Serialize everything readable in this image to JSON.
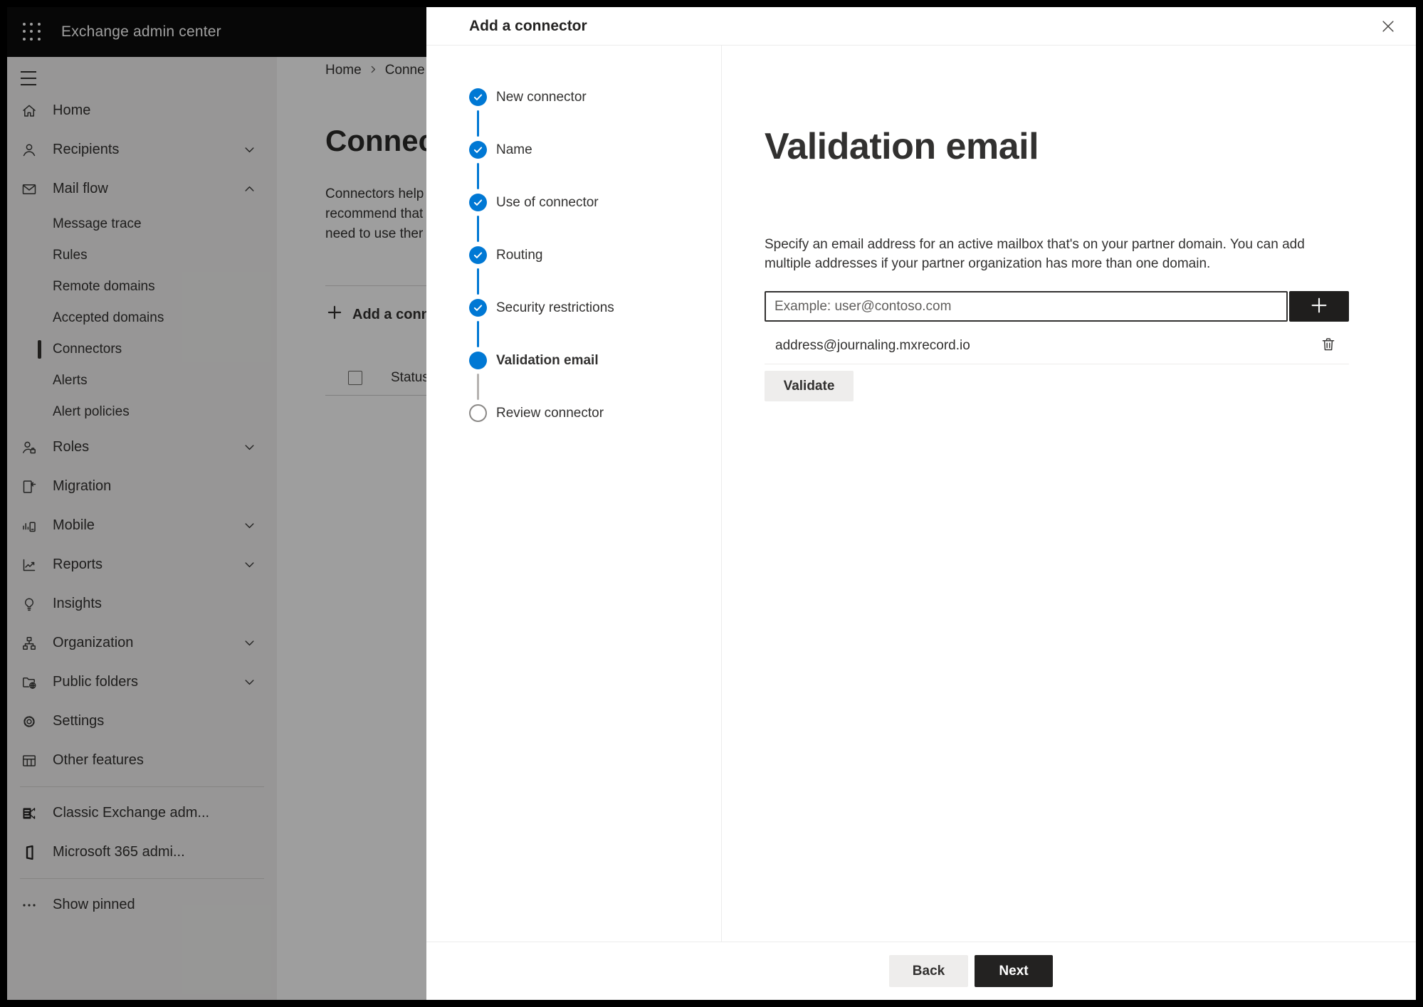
{
  "app": {
    "title": "Exchange admin center"
  },
  "colors": {
    "accent": "#0078d4",
    "dark_button": "#1f1e1d",
    "text": "#323130"
  },
  "sidebar": {
    "items": [
      {
        "label": "Home",
        "icon": "home-icon"
      },
      {
        "label": "Recipients",
        "icon": "person-icon",
        "chevron": "down"
      },
      {
        "label": "Mail flow",
        "icon": "mail-icon",
        "chevron": "up"
      },
      {
        "label": "Message trace",
        "child": true
      },
      {
        "label": "Rules",
        "child": true
      },
      {
        "label": "Remote domains",
        "child": true
      },
      {
        "label": "Accepted domains",
        "child": true
      },
      {
        "label": "Connectors",
        "child": true,
        "selected": true
      },
      {
        "label": "Alerts",
        "child": true
      },
      {
        "label": "Alert policies",
        "child": true
      },
      {
        "label": "Roles",
        "icon": "roles-icon",
        "chevron": "down"
      },
      {
        "label": "Migration",
        "icon": "migration-icon"
      },
      {
        "label": "Mobile",
        "icon": "mobile-icon",
        "chevron": "down"
      },
      {
        "label": "Reports",
        "icon": "reports-icon",
        "chevron": "down"
      },
      {
        "label": "Insights",
        "icon": "insights-icon"
      },
      {
        "label": "Organization",
        "icon": "organization-icon",
        "chevron": "down"
      },
      {
        "label": "Public folders",
        "icon": "public-folders-icon",
        "chevron": "down"
      },
      {
        "label": "Settings",
        "icon": "settings-icon"
      },
      {
        "label": "Other features",
        "icon": "other-features-icon"
      }
    ],
    "footer_items": [
      {
        "label": "Classic Exchange adm...",
        "icon": "classic-exchange-icon"
      },
      {
        "label": "Microsoft 365 admi...",
        "icon": "microsoft-365-icon"
      }
    ],
    "show_pinned": {
      "label": "Show pinned",
      "icon": "ellipsis-icon"
    }
  },
  "page": {
    "breadcrumb": {
      "home": "Home",
      "current": "Conne"
    },
    "title": "Connec",
    "description_lines": [
      "Connectors help",
      "recommend that",
      "need to use ther"
    ],
    "add_button_label": "Add a conn",
    "table_header": "Status"
  },
  "modal": {
    "title": "Add a connector",
    "steps": [
      {
        "label": "New connector",
        "state": "completed"
      },
      {
        "label": "Name",
        "state": "completed"
      },
      {
        "label": "Use of connector",
        "state": "completed"
      },
      {
        "label": "Routing",
        "state": "completed"
      },
      {
        "label": "Security restrictions",
        "state": "completed"
      },
      {
        "label": "Validation email",
        "state": "current"
      },
      {
        "label": "Review connector",
        "state": "upcoming"
      }
    ],
    "heading": "Validation email",
    "description_lines": [
      "Specify an email address for an active mailbox that's on your partner domain. You can add",
      "multiple addresses if your partner organization has more than one domain."
    ],
    "email_input": {
      "value": "",
      "placeholder": "Example: user@contoso.com"
    },
    "addresses": [
      "address@journaling.mxrecord.io"
    ],
    "validate_label": "Validate",
    "back_label": "Back",
    "next_label": "Next"
  }
}
